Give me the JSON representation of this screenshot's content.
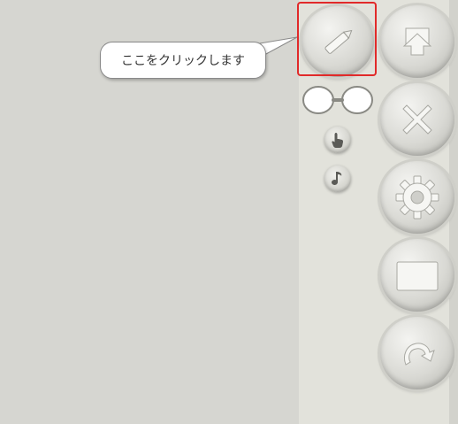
{
  "callout": {
    "text": "ここをクリックします"
  },
  "toolbar": {
    "edit": {
      "icon": "pencil-icon"
    },
    "glasses": {
      "icon": "glasses-icon"
    },
    "pointer": {
      "icon": "hand-pointer-icon"
    },
    "sound": {
      "icon": "music-note-icon"
    },
    "buttons": [
      {
        "icon": "upload-arrow-icon"
      },
      {
        "icon": "close-x-icon"
      },
      {
        "icon": "gear-icon"
      },
      {
        "icon": "blank-card-icon"
      },
      {
        "icon": "undo-arrow-icon"
      }
    ]
  },
  "colors": {
    "highlight": "#e12a2a",
    "background": "#d6d6d1",
    "panel": "#e2e2db"
  }
}
